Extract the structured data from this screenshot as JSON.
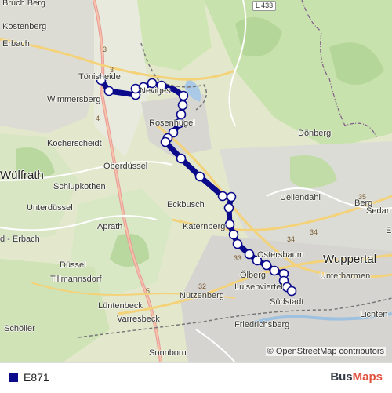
{
  "map": {
    "route_color": "#0a0a8a",
    "stop_fill": "#ffffff",
    "places": {
      "kostenberg": "Kostenberg",
      "bruchberg": "Bruch Berg",
      "erbach_top": "Erbach",
      "tonisheide": "Tönisheide",
      "wimmersberg": "Wimmersberg",
      "neviges": "Neviges",
      "rosenhugel": "Rosenhügel",
      "donberg": "Dönberg",
      "kocherscheidt": "Kocherscheidt",
      "oberdussel": "Oberdüssel",
      "wulfrath": "Wülfrath",
      "schlupkothen": "Schlupkothen",
      "eckbusch": "Eckbusch",
      "uellendahl": "Uellendahl",
      "unterdussel": "Unterdüssel",
      "aprath": "Aprath",
      "katernberg": "Katernberg",
      "berg": "Berg",
      "sedan": "Sedan",
      "dbach_erbach": "d - Erbach",
      "ostersbaum": "Ostersbaum",
      "wuppertal": "Wuppertal",
      "dussel": "Düssel",
      "olberg": "Ölberg",
      "unterbarmen": "Unterbarmen",
      "tillmannsdorf": "Tillmannsdorf",
      "luisenviertel": "Luisenviertel",
      "nutzenberg": "Nützenberg",
      "luntenbeck": "Lüntenbeck",
      "sudstadt": "Südstadt",
      "varresbeck": "Varresbeck",
      "lichten": "Lichten",
      "scholler": "Schöller",
      "friedrichsberg": "Friedrichsberg",
      "sonnborn": "Sonnborn",
      "e": "E"
    },
    "road_labels": {
      "l433": "L 433",
      "r3a": "3",
      "r3b": "3",
      "r4": "4",
      "r5": "5",
      "r32": "32",
      "r33": "33",
      "r34a": "34",
      "r34b": "34",
      "r35": "35"
    },
    "attribution": "© OpenStreetMap contributors"
  },
  "legend": {
    "route_name": "E871",
    "brand_part1": "Bus",
    "brand_part2": "Maps"
  }
}
